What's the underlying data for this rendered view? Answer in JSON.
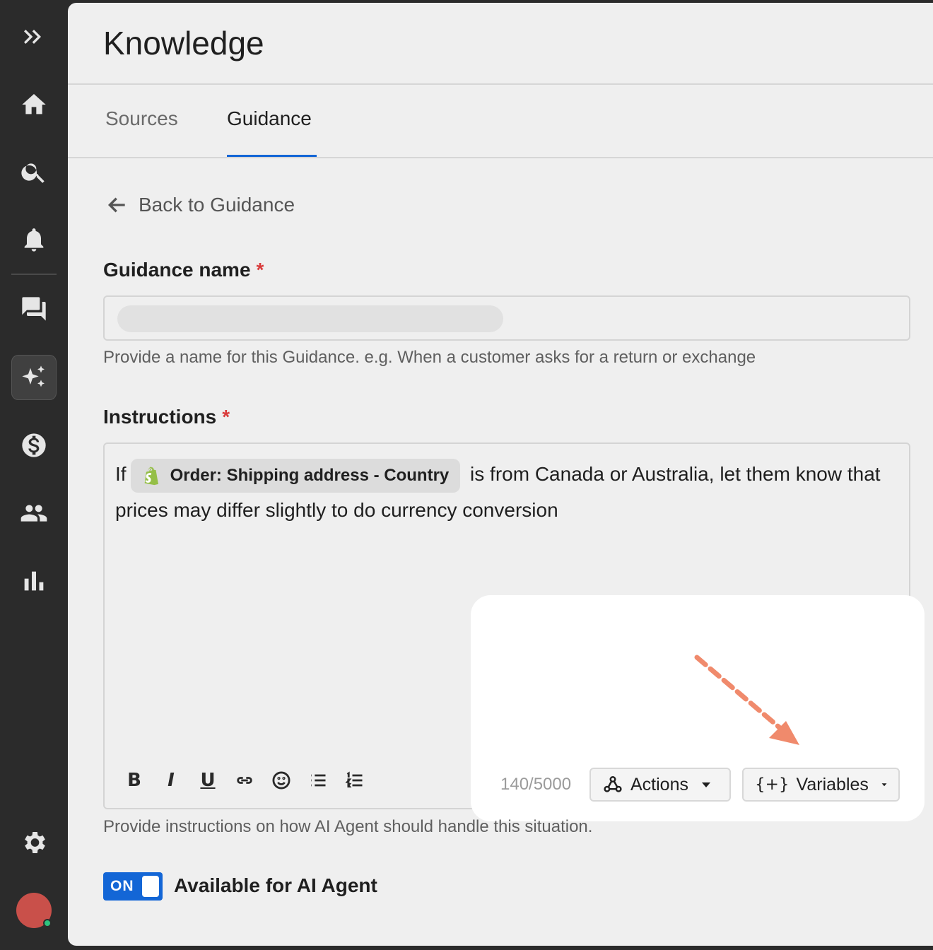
{
  "sidebar": {
    "items": [
      {
        "icon": "expand-icon"
      },
      {
        "icon": "home-icon"
      },
      {
        "icon": "search-icon"
      },
      {
        "icon": "bell-icon"
      },
      {
        "icon": "chat-icon"
      },
      {
        "icon": "ai-sparkle-icon",
        "active": true
      },
      {
        "icon": "dollar-icon"
      },
      {
        "icon": "users-icon"
      },
      {
        "icon": "bar-chart-icon"
      },
      {
        "icon": "gear-icon"
      }
    ]
  },
  "header": {
    "title": "Knowledge"
  },
  "tabs": [
    {
      "label": "Sources",
      "active": false
    },
    {
      "label": "Guidance",
      "active": true
    }
  ],
  "back_link": {
    "label": "Back to Guidance"
  },
  "guidance_name": {
    "label": "Guidance name",
    "required_mark": "*",
    "value": "",
    "helper": "Provide a name for this Guidance. e.g. When a customer asks for a return or exchange"
  },
  "instructions": {
    "label": "Instructions",
    "required_mark": "*",
    "text_before": "If",
    "variable_chip": "Order: Shipping address - Country",
    "text_after": "is from Canada or Australia, let them know that prices may differ slightly to do currency conversion",
    "helper": "Provide instructions on how AI Agent should handle this situation.",
    "char_count": "140/5000",
    "toolbar": {
      "bold": "B",
      "italic": "I",
      "underline": "U"
    },
    "actions_label": "Actions",
    "variables_prefix": "{+}",
    "variables_label": "Variables"
  },
  "availability": {
    "toggle_label": "ON",
    "text": "Available for AI Agent"
  },
  "colors": {
    "accent": "#1366d6",
    "annotation_arrow": "#f08a6c",
    "required": "#d93a3a"
  }
}
